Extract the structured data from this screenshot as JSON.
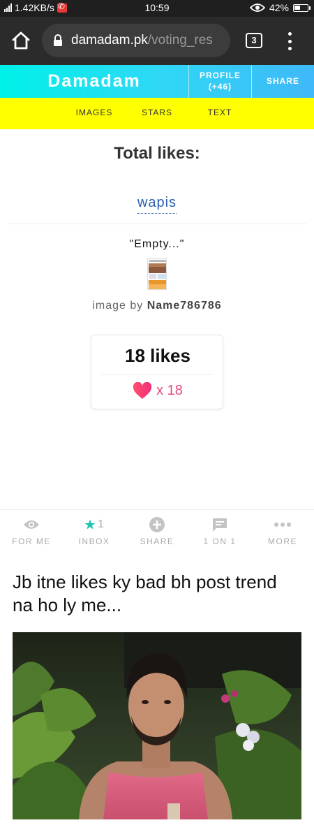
{
  "status_bar": {
    "net_speed": "1.42KB/s",
    "time": "10:59",
    "battery": "42%",
    "battery_level": 0.42
  },
  "browser": {
    "url_host": "damadam.pk",
    "url_path": "/voting_res",
    "tab_count": "3"
  },
  "site_header": {
    "brand": "Damadam",
    "profile_label": "PROFILE",
    "profile_count": "(+46)",
    "share_label": "SHARE"
  },
  "sub_nav": {
    "items": [
      {
        "label": "IMAGES"
      },
      {
        "label": "STARS"
      },
      {
        "label": "TEXT"
      }
    ]
  },
  "main": {
    "title": "Total likes:",
    "back_link": "wapis",
    "caption": "\"Empty...\"",
    "image_by_prefix": "image by",
    "image_by_user": "Name786786",
    "likes_total": "18 likes",
    "likes_multiplier": "x 18"
  },
  "bottom_nav": {
    "items": [
      {
        "label": "FOR ME",
        "icon": "eye-icon"
      },
      {
        "label": "INBOX",
        "icon": "star-icon",
        "count": "1"
      },
      {
        "label": "SHARE",
        "icon": "plus-circle-icon"
      },
      {
        "label": "1 ON 1",
        "icon": "chat-bubble-icon"
      },
      {
        "label": "MORE",
        "icon": "ellipsis-icon"
      }
    ]
  },
  "post": {
    "title": "Jb itne likes ky bad bh post trend na ho ly me..."
  },
  "colors": {
    "header_gradient_start": "#00f1e8",
    "header_gradient_end": "#3fb8f8",
    "subnav_bg": "#ffff00",
    "link_blue": "#2a5db0",
    "heart_pink": "#e84a7a",
    "inbox_star": "#1ec6b0"
  }
}
